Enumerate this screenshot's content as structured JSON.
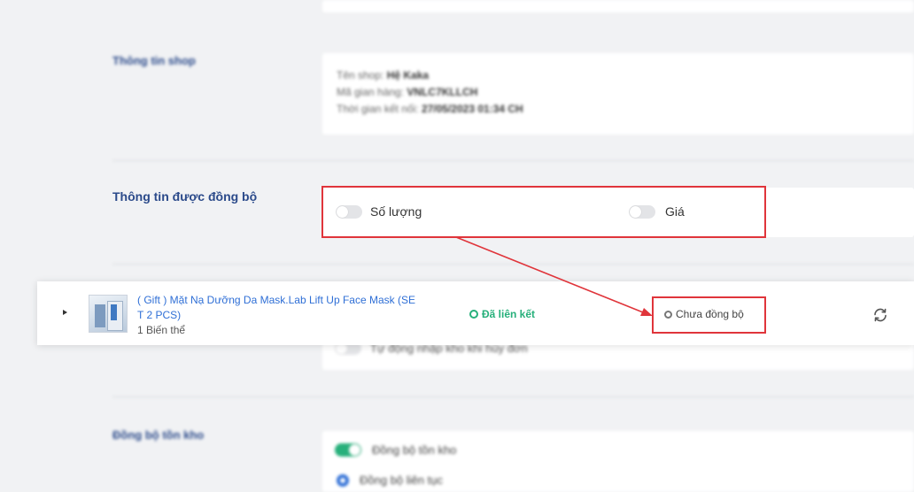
{
  "shop_info": {
    "label": "Thông tin shop",
    "name_label": "Tên shop:",
    "name_value": "Hệ Kaka",
    "code_label": "Mã gian hàng:",
    "code_value": "VNLC7KLLCH",
    "time_label": "Thời gian kết nối:",
    "time_value": "27/05/2023 01:34 CH"
  },
  "sync_info": {
    "label": "Thông tin được đồng bộ",
    "quantity_label": "Số lượng",
    "price_label": "Giá"
  },
  "behind_option": {
    "label": "Tự động nhập kho khi hủy đơn"
  },
  "stock_sync": {
    "label": "Đồng bộ tồn kho",
    "option_toggle_label": "Đồng bộ tồn kho",
    "option_radio_label": "Đồng bộ liên tục"
  },
  "product_row": {
    "title": "( Gift ) Mặt Nạ Dưỡng Da Mask.Lab Lift Up Face Mask (SET 2 PCS)",
    "title_line1": "( Gift ) Mặt Nạ Dưỡng Da Mask.Lab Lift Up Face Mask (SE",
    "title_line2": "T 2 PCS)",
    "variants": "1 Biến thể",
    "link_status": "Đã liên kết",
    "sync_status": "Chưa đồng bộ"
  },
  "colors": {
    "link_status": "#27b07b",
    "title_link": "#2f6fd6",
    "highlight": "#e0353b"
  }
}
